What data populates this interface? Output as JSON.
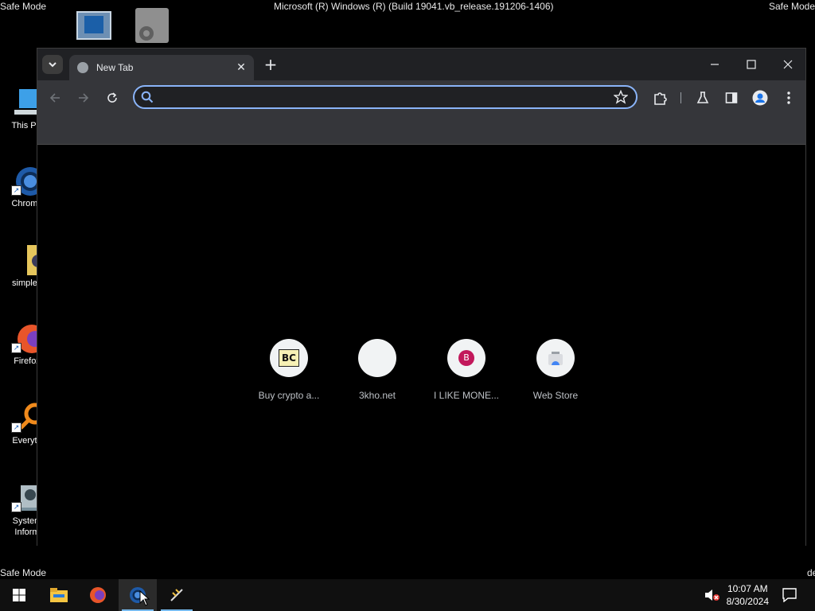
{
  "os": {
    "safe_mode_label": "Safe Mode",
    "build_banner": "Microsoft (R) Windows (R) (Build 19041.vb_release.191206-1406)"
  },
  "desktop_icons": [
    {
      "label": "This PC",
      "icon": "computer-icon"
    },
    {
      "label": "Chrome",
      "icon": "chrome-icon"
    },
    {
      "label": "simpleu",
      "icon": "folder-icon"
    },
    {
      "label": "Firefox",
      "icon": "firefox-icon"
    },
    {
      "label": "Everyth",
      "icon": "everything-search-icon"
    },
    {
      "label": "System Inform",
      "icon": "system-information-icon"
    }
  ],
  "browser": {
    "tab": {
      "title": "New Tab",
      "close": "✕"
    },
    "new_tab": "+",
    "omnibox": {
      "value": "",
      "placeholder": ""
    },
    "shortcuts": [
      {
        "label": "Buy crypto a...",
        "badge": "BC"
      },
      {
        "label": "3kho.net",
        "badge": ""
      },
      {
        "label": "I LIKE MONE...",
        "badge": "B"
      },
      {
        "label": "Web Store",
        "badge": ""
      }
    ]
  },
  "taskbar": {
    "time": "10:07 AM",
    "date": "8/30/2024"
  },
  "colors": {
    "accent": "#8ab4f8",
    "window_frame": "#202124",
    "toolbar": "#35363a",
    "badge_pink": "#c2185b"
  }
}
